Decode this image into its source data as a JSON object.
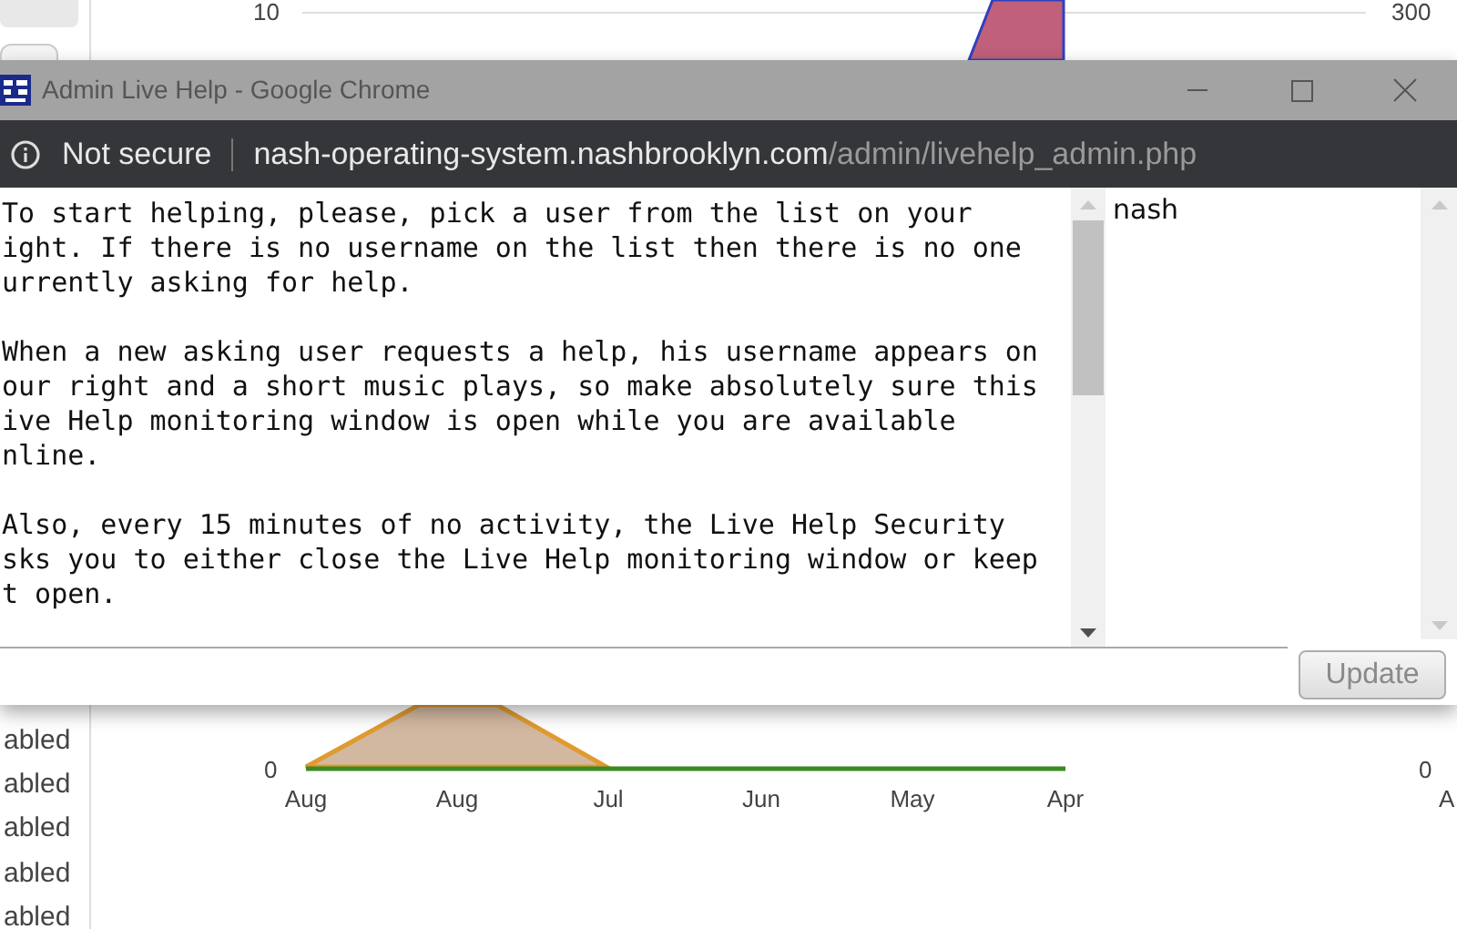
{
  "background_page": {
    "sidebar_labels": [
      "abled",
      "abled",
      "abled",
      "abled",
      "abled"
    ],
    "chart_top": {
      "y_tick": "10",
      "right_tick": "300"
    },
    "chart_bottom": {
      "y_tick": "0",
      "x_labels": [
        "Aug",
        "Aug",
        "Jul",
        "Jun",
        "May",
        "Apr"
      ],
      "right_tick": "0",
      "right_label": "A"
    }
  },
  "window": {
    "title": "Admin Live Help - Google Chrome",
    "address_bar": {
      "security": "Not secure",
      "host": "nash-operating-system.nashbrooklyn.com",
      "path": "/admin/livehelp_admin.php"
    },
    "message_paragraphs": [
      [
        "To start helping, please, pick a user from the list on your",
        "ight. If there is no username on the list then there is no one",
        "urrently asking for help."
      ],
      [
        "When a new asking user requests a help, his username appears on",
        "our right and a short music plays, so make absolutely sure this",
        "ive Help monitoring window is open while you are available",
        "nline."
      ],
      [
        "Also, every 15 minutes of no activity, the Live Help Security",
        "sks you to either close the Live Help monitoring window or keep",
        "t open."
      ]
    ],
    "users": [
      "nash"
    ],
    "button": "Update"
  }
}
